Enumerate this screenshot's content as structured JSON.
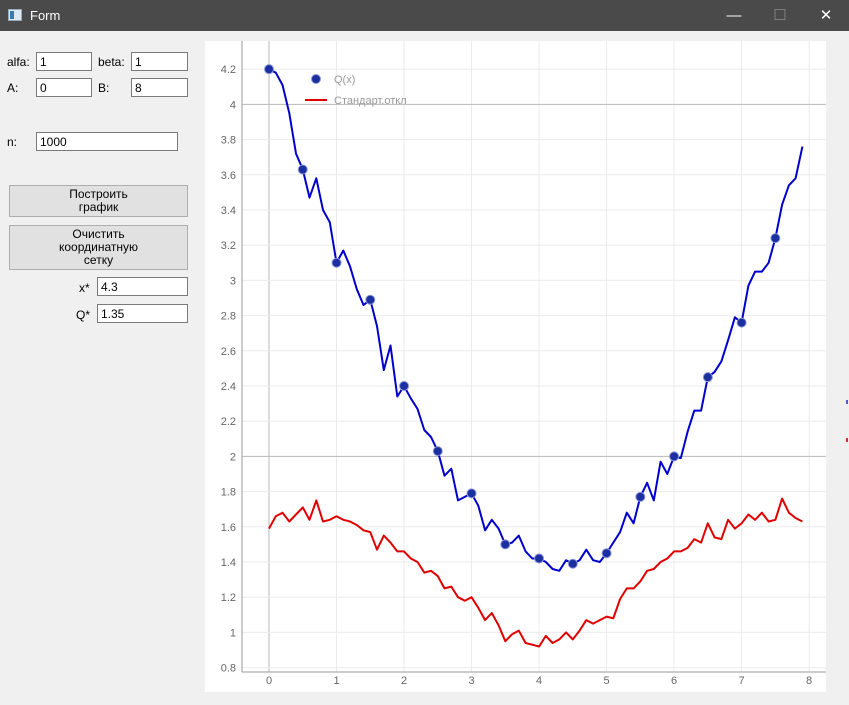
{
  "window": {
    "title": "Form",
    "minimize_glyph": "—",
    "maximize_glyph": "☐",
    "close_glyph": "✕"
  },
  "params": {
    "alfa_label": "alfa:",
    "alfa_value": "1",
    "beta_label": "beta:",
    "beta_value": "1",
    "A_label": "A:",
    "A_value": "0",
    "B_label": "B:",
    "B_value": "8",
    "n_label": "n:",
    "n_value": "1000"
  },
  "buttons": {
    "plot_label": "Построить\nграфик",
    "clear_label": "Очистить\nкоординатную\nсетку"
  },
  "results": {
    "xstar_label": "x*",
    "xstar_value": "4.3",
    "qstar_label": "Q*",
    "qstar_value": "1.35"
  },
  "chart_data": {
    "type": "line",
    "xlim": [
      -0.4,
      8.25
    ],
    "ylim": [
      0.775,
      4.36
    ],
    "xticks": [
      "0",
      "1",
      "2",
      "3",
      "4",
      "5",
      "6",
      "7",
      "8"
    ],
    "yticks": [
      "0.8",
      "1",
      "1.2",
      "1.4",
      "1.6",
      "1.8",
      "2",
      "2.2",
      "2.4",
      "2.6",
      "2.8",
      "3",
      "3.2",
      "3.4",
      "3.6",
      "3.8",
      "4",
      "4.2"
    ],
    "grid": true,
    "legend_position": "top-left",
    "series": [
      {
        "name": "Q(x)",
        "color": "#0000cc",
        "marker_color": "#1c2fa0",
        "line": [
          [
            0,
            4.2
          ],
          [
            0.1,
            4.18
          ],
          [
            0.2,
            4.11
          ],
          [
            0.3,
            3.95
          ],
          [
            0.4,
            3.72
          ],
          [
            0.5,
            3.63
          ],
          [
            0.6,
            3.47
          ],
          [
            0.7,
            3.58
          ],
          [
            0.8,
            3.4
          ],
          [
            0.9,
            3.33
          ],
          [
            1.0,
            3.1
          ],
          [
            1.1,
            3.17
          ],
          [
            1.2,
            3.08
          ],
          [
            1.3,
            2.95
          ],
          [
            1.4,
            2.86
          ],
          [
            1.5,
            2.89
          ],
          [
            1.6,
            2.74
          ],
          [
            1.7,
            2.49
          ],
          [
            1.8,
            2.63
          ],
          [
            1.9,
            2.34
          ],
          [
            2.0,
            2.4
          ],
          [
            2.1,
            2.33
          ],
          [
            2.2,
            2.27
          ],
          [
            2.3,
            2.15
          ],
          [
            2.4,
            2.11
          ],
          [
            2.5,
            2.03
          ],
          [
            2.6,
            1.89
          ],
          [
            2.7,
            1.93
          ],
          [
            2.8,
            1.75
          ],
          [
            2.9,
            1.77
          ],
          [
            3.0,
            1.79
          ],
          [
            3.1,
            1.72
          ],
          [
            3.2,
            1.58
          ],
          [
            3.3,
            1.64
          ],
          [
            3.4,
            1.59
          ],
          [
            3.5,
            1.5
          ],
          [
            3.6,
            1.51
          ],
          [
            3.7,
            1.55
          ],
          [
            3.8,
            1.46
          ],
          [
            3.9,
            1.42
          ],
          [
            4.0,
            1.42
          ],
          [
            4.1,
            1.4
          ],
          [
            4.2,
            1.36
          ],
          [
            4.3,
            1.35
          ],
          [
            4.4,
            1.41
          ],
          [
            4.5,
            1.39
          ],
          [
            4.6,
            1.41
          ],
          [
            4.7,
            1.47
          ],
          [
            4.8,
            1.41
          ],
          [
            4.9,
            1.4
          ],
          [
            5.0,
            1.45
          ],
          [
            5.1,
            1.51
          ],
          [
            5.2,
            1.57
          ],
          [
            5.3,
            1.68
          ],
          [
            5.4,
            1.62
          ],
          [
            5.5,
            1.77
          ],
          [
            5.6,
            1.85
          ],
          [
            5.7,
            1.75
          ],
          [
            5.8,
            1.97
          ],
          [
            5.9,
            1.9
          ],
          [
            6.0,
            2.0
          ],
          [
            6.1,
            1.99
          ],
          [
            6.2,
            2.14
          ],
          [
            6.3,
            2.26
          ],
          [
            6.4,
            2.26
          ],
          [
            6.5,
            2.45
          ],
          [
            6.6,
            2.48
          ],
          [
            6.7,
            2.54
          ],
          [
            6.8,
            2.66
          ],
          [
            6.9,
            2.79
          ],
          [
            7.0,
            2.76
          ],
          [
            7.1,
            2.97
          ],
          [
            7.2,
            3.05
          ],
          [
            7.3,
            3.05
          ],
          [
            7.4,
            3.1
          ],
          [
            7.5,
            3.24
          ],
          [
            7.6,
            3.43
          ],
          [
            7.7,
            3.54
          ],
          [
            7.8,
            3.58
          ],
          [
            7.9,
            3.76
          ]
        ],
        "markers": [
          [
            0,
            4.2
          ],
          [
            0.5,
            3.63
          ],
          [
            1.0,
            3.1
          ],
          [
            1.5,
            2.89
          ],
          [
            2.0,
            2.4
          ],
          [
            2.5,
            2.03
          ],
          [
            3.0,
            1.79
          ],
          [
            3.5,
            1.5
          ],
          [
            4.0,
            1.42
          ],
          [
            4.5,
            1.39
          ],
          [
            5.0,
            1.45
          ],
          [
            5.5,
            1.77
          ],
          [
            6.0,
            2.0
          ],
          [
            6.5,
            2.45
          ],
          [
            7.0,
            2.76
          ],
          [
            7.5,
            3.24
          ]
        ]
      },
      {
        "name": "Стандарт.откл",
        "color": "#e00000",
        "line": [
          [
            0,
            1.59
          ],
          [
            0.1,
            1.66
          ],
          [
            0.2,
            1.68
          ],
          [
            0.3,
            1.63
          ],
          [
            0.4,
            1.67
          ],
          [
            0.5,
            1.71
          ],
          [
            0.6,
            1.64
          ],
          [
            0.7,
            1.75
          ],
          [
            0.8,
            1.63
          ],
          [
            0.9,
            1.64
          ],
          [
            1.0,
            1.66
          ],
          [
            1.1,
            1.64
          ],
          [
            1.2,
            1.63
          ],
          [
            1.3,
            1.61
          ],
          [
            1.4,
            1.58
          ],
          [
            1.5,
            1.57
          ],
          [
            1.6,
            1.47
          ],
          [
            1.7,
            1.55
          ],
          [
            1.8,
            1.51
          ],
          [
            1.9,
            1.46
          ],
          [
            2.0,
            1.46
          ],
          [
            2.1,
            1.42
          ],
          [
            2.2,
            1.4
          ],
          [
            2.3,
            1.34
          ],
          [
            2.4,
            1.35
          ],
          [
            2.5,
            1.32
          ],
          [
            2.6,
            1.25
          ],
          [
            2.7,
            1.26
          ],
          [
            2.8,
            1.2
          ],
          [
            2.9,
            1.18
          ],
          [
            3.0,
            1.2
          ],
          [
            3.1,
            1.14
          ],
          [
            3.2,
            1.07
          ],
          [
            3.3,
            1.11
          ],
          [
            3.4,
            1.04
          ],
          [
            3.5,
            0.95
          ],
          [
            3.6,
            0.99
          ],
          [
            3.7,
            1.01
          ],
          [
            3.8,
            0.94
          ],
          [
            3.9,
            0.93
          ],
          [
            4.0,
            0.92
          ],
          [
            4.1,
            0.98
          ],
          [
            4.2,
            0.94
          ],
          [
            4.3,
            0.96
          ],
          [
            4.4,
            1.0
          ],
          [
            4.5,
            0.96
          ],
          [
            4.6,
            1.01
          ],
          [
            4.7,
            1.07
          ],
          [
            4.8,
            1.05
          ],
          [
            4.9,
            1.07
          ],
          [
            5.0,
            1.09
          ],
          [
            5.1,
            1.08
          ],
          [
            5.2,
            1.19
          ],
          [
            5.3,
            1.25
          ],
          [
            5.4,
            1.25
          ],
          [
            5.5,
            1.29
          ],
          [
            5.6,
            1.35
          ],
          [
            5.7,
            1.36
          ],
          [
            5.8,
            1.4
          ],
          [
            5.9,
            1.42
          ],
          [
            6.0,
            1.46
          ],
          [
            6.1,
            1.46
          ],
          [
            6.2,
            1.48
          ],
          [
            6.3,
            1.53
          ],
          [
            6.4,
            1.51
          ],
          [
            6.5,
            1.62
          ],
          [
            6.6,
            1.54
          ],
          [
            6.7,
            1.53
          ],
          [
            6.8,
            1.64
          ],
          [
            6.9,
            1.59
          ],
          [
            7.0,
            1.62
          ],
          [
            7.1,
            1.67
          ],
          [
            7.2,
            1.64
          ],
          [
            7.3,
            1.68
          ],
          [
            7.4,
            1.63
          ],
          [
            7.5,
            1.64
          ],
          [
            7.6,
            1.76
          ],
          [
            7.7,
            1.68
          ],
          [
            7.8,
            1.65
          ],
          [
            7.9,
            1.63
          ]
        ]
      }
    ]
  }
}
